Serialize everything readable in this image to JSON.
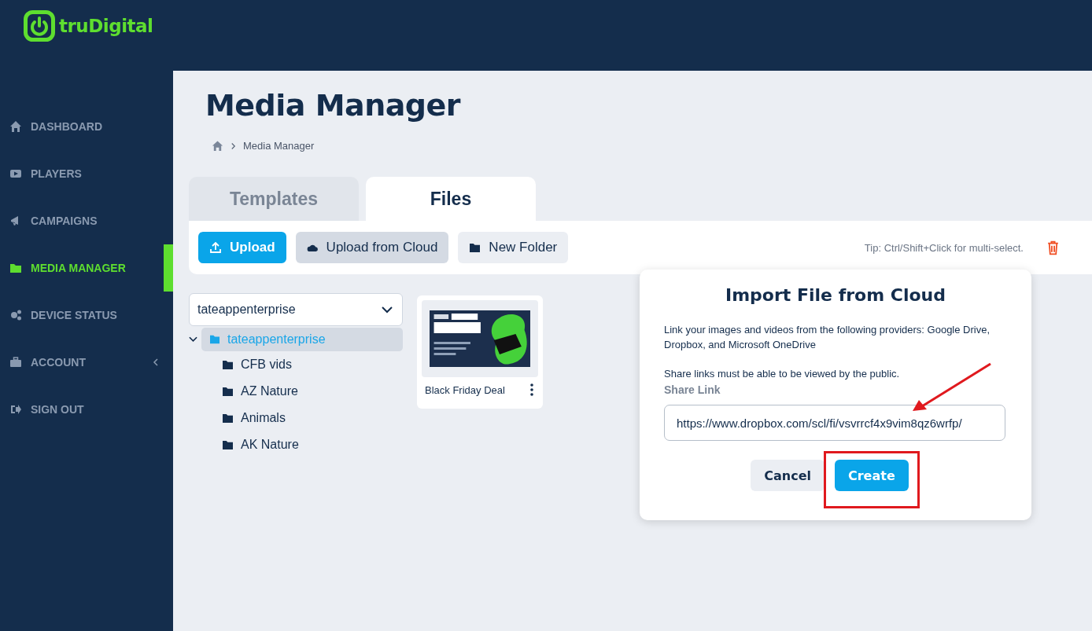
{
  "brand": {
    "name": "truDigital"
  },
  "sidebar": {
    "items": [
      {
        "label": "DASHBOARD",
        "selected": false
      },
      {
        "label": "PLAYERS",
        "selected": false
      },
      {
        "label": "CAMPAIGNS",
        "selected": false
      },
      {
        "label": "MEDIA MANAGER",
        "selected": true
      },
      {
        "label": "DEVICE STATUS",
        "selected": false
      },
      {
        "label": "ACCOUNT",
        "selected": false,
        "expanded": false
      },
      {
        "label": "SIGN OUT",
        "selected": false
      }
    ]
  },
  "page": {
    "title": "Media Manager",
    "breadcrumb": [
      "Media Manager"
    ]
  },
  "tabs": [
    {
      "label": "Templates",
      "selected": false
    },
    {
      "label": "Files",
      "selected": true
    }
  ],
  "toolbar": {
    "buttons": [
      {
        "label": "Upload",
        "kind": "primary"
      },
      {
        "label": "Upload from Cloud",
        "kind": "active"
      },
      {
        "label": "New Folder",
        "kind": "plain"
      }
    ],
    "tip": "Tip: Ctrl/Shift+Click for multi-select."
  },
  "workspace": {
    "value": "tateappenterprise"
  },
  "tree": {
    "label": "tateappenterprise",
    "expanded": true,
    "selected": true,
    "children": [
      {
        "label": "CFB vids",
        "selected": false
      },
      {
        "label": "AZ Nature",
        "selected": false
      },
      {
        "label": "Animals",
        "selected": false
      },
      {
        "label": "AK Nature",
        "selected": false
      }
    ]
  },
  "files": [
    {
      "name": "Black Friday Deal",
      "kind": "picture"
    }
  ],
  "dialog": {
    "title": "Import File from Cloud",
    "text": "Link your images and videos from the following providers: Google Drive, Dropbox, and Microsoft OneDrive",
    "note": "Share links must be able to be viewed by the public.",
    "field_label": "Share Link",
    "field_value": "https://www.dropbox.com/scl/fi/vsvrrcf4x9vim8qz6wrfp/",
    "buttons": [
      {
        "label": "Cancel",
        "kind": "secondary"
      },
      {
        "label": "Create",
        "kind": "primary",
        "highlighted": true
      }
    ]
  }
}
